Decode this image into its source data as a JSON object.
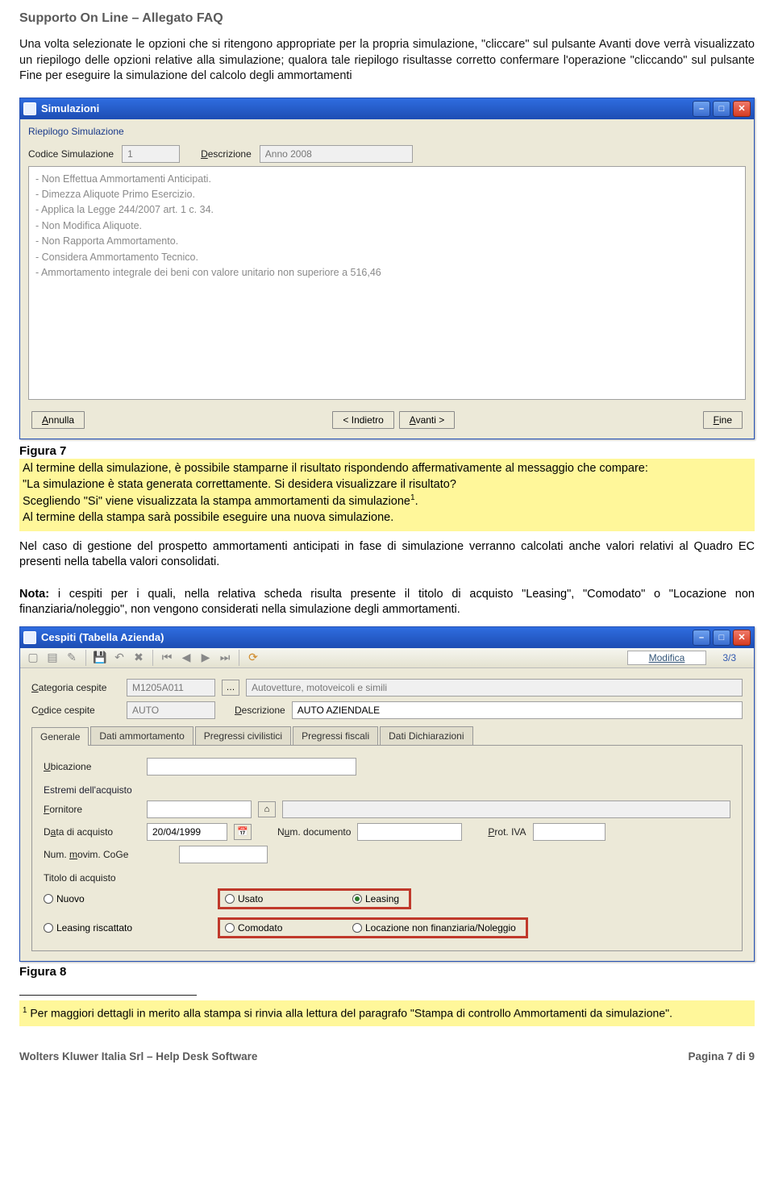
{
  "header": {
    "title": "Supporto On Line – Allegato FAQ"
  },
  "intro": "Una volta selezionate le opzioni che si ritengono appropriate per la propria simulazione, \"cliccare\" sul pulsante Avanti dove verrà visualizzato un riepilogo delle opzioni relative alla simulazione; qualora tale riepilogo risultasse corretto confermare l'operazione \"cliccando\" sul pulsante Fine per eseguire la simulazione del calcolo degli ammortamenti",
  "win1": {
    "title": "Simulazioni",
    "subtitle": "Riepilogo Simulazione",
    "codice_label": "Codice Simulazione",
    "codice_value": "1",
    "descr_label": "Descrizione",
    "descr_value": "Anno 2008",
    "memo": "- Non Effettua Ammortamenti Anticipati.\n- Dimezza Aliquote Primo Esercizio.\n- Applica la Legge 244/2007 art. 1 c. 34.\n- Non Modifica Aliquote.\n- Non Rapporta Ammortamento.\n- Considera Ammortamento Tecnico.\n- Ammortamento integrale dei beni con valore unitario non superiore a 516,46",
    "btn_annulla": "Annulla",
    "btn_indietro": "< Indietro",
    "btn_avanti": "Avanti >",
    "btn_fine": "Fine"
  },
  "figure7": {
    "label": "Figura 7"
  },
  "hl": {
    "p1": "Al termine della simulazione, è possibile stamparne il risultato rispondendo affermativamente al messaggio che compare:",
    "p2": "\"La simulazione è stata generata correttamente. Si desidera visualizzare il risultato?",
    "p3a": "Scegliendo \"Si\" viene visualizzata la stampa ammortamenti da simulazione",
    "p3b": ".",
    "p4": "Al termine della stampa sarà possibile eseguire una nuova simulazione."
  },
  "after1": "Nel caso di gestione del prospetto ammortamenti anticipati in fase di simulazione verranno calcolati anche valori relativi al Quadro EC presenti nella tabella valori consolidati.",
  "nota_label": "Nota:",
  "nota_text": " i cespiti per i quali, nella relativa scheda risulta presente il titolo di acquisto \"Leasing\", \"Comodato\" o \"Locazione non finanziaria/noleggio\", non vengono considerati nella simulazione degli ammortamenti.",
  "win2": {
    "title": "Cespiti (Tabella Azienda)",
    "modifica": "Modifica",
    "counter": "3/3",
    "categoria_label": "Categoria cespite",
    "categoria_value": "M1205A011",
    "categoria_descr": "Autovetture, motoveicoli e simili",
    "codice_label": "Codice cespite",
    "codice_value": "AUTO",
    "descr_label": "Descrizione",
    "descr_value": "AUTO AZIENDALE",
    "tabs": [
      "Generale",
      "Dati ammortamento",
      "Pregressi civilistici",
      "Pregressi fiscali",
      "Dati Dichiarazioni"
    ],
    "ubic_label": "Ubicazione",
    "estremi_label": "Estremi dell'acquisto",
    "fornitore_label": "Fornitore",
    "data_label": "Data di acquisto",
    "data_value": "20/04/1999",
    "numdoc_label": "Num. documento",
    "prot_label": "Prot. IVA",
    "coge_label": "Num. movim. CoGe",
    "titolo_label": "Titolo di acquisto",
    "opt_nuovo": "Nuovo",
    "opt_usato": "Usato",
    "opt_leasing": "Leasing",
    "opt_risc": "Leasing riscattato",
    "opt_comodato": "Comodato",
    "opt_locazione": "Locazione non finanziaria/Noleggio"
  },
  "figure8": {
    "label": "Figura 8"
  },
  "footnote": {
    "num": "1",
    "text": " Per maggiori dettagli in merito alla stampa si rinvia alla lettura del paragrafo \"Stampa di controllo Ammortamenti da simulazione\"."
  },
  "footer": {
    "left": "Wolters Kluwer Italia Srl – Help Desk Software",
    "right": "Pagina 7 di 9"
  }
}
